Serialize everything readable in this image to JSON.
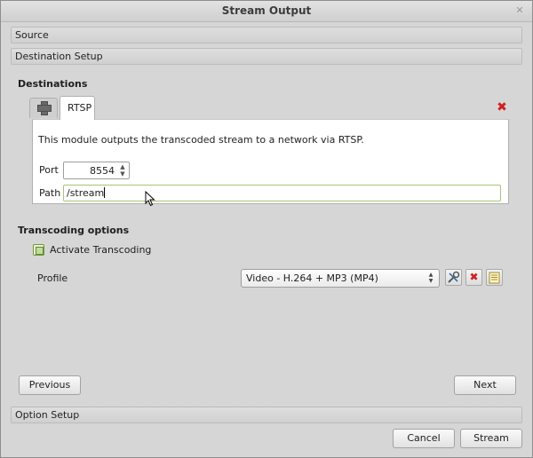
{
  "window": {
    "title": "Stream Output",
    "close_glyph": "✕"
  },
  "sections": {
    "source": "Source",
    "destination_setup": "Destination Setup",
    "option_setup": "Option Setup"
  },
  "destinations": {
    "heading": "Destinations",
    "add_tab_icon": "plus-icon",
    "active_tab": "RTSP",
    "remove_icon_glyph": "✖",
    "description": "This module outputs the transcoded stream to a network via RTSP.",
    "port_label": "Port",
    "port_value": "8554",
    "path_label": "Path",
    "path_value": "/stream"
  },
  "transcoding": {
    "heading": "Transcoding options",
    "activate_label": "Activate Transcoding",
    "activate_checked": true,
    "profile_label": "Profile",
    "profile_selected": "Video - H.264 + MP3 (MP4)",
    "edit_icon": "wrench-screwdriver-icon",
    "delete_icon_glyph": "✖",
    "new_icon": "new-profile-icon"
  },
  "buttons": {
    "previous": "Previous",
    "next": "Next",
    "cancel": "Cancel",
    "stream": "Stream"
  },
  "colors": {
    "accent_green": "#6d9a3a",
    "delete_red": "#d21e1e"
  }
}
